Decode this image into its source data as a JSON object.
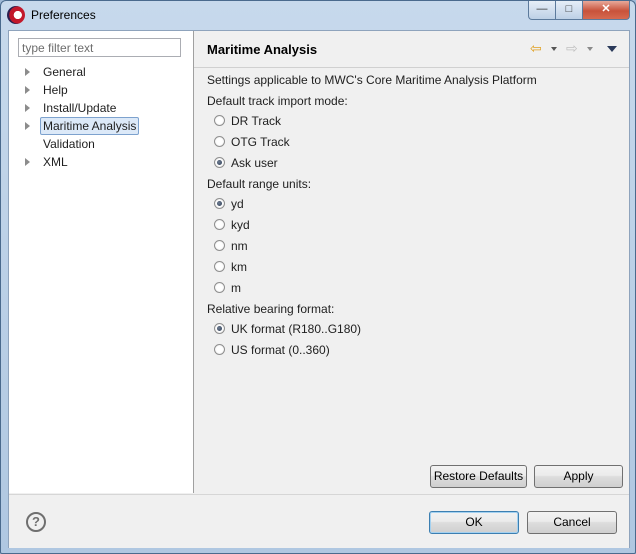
{
  "window": {
    "title": "Preferences"
  },
  "titlebar_controls": {
    "minimize": "—",
    "maximize": "□",
    "close": "✕"
  },
  "filter": {
    "placeholder": "type filter text"
  },
  "tree": {
    "items": [
      {
        "label": "General",
        "expandable": true,
        "selected": false
      },
      {
        "label": "Help",
        "expandable": true,
        "selected": false
      },
      {
        "label": "Install/Update",
        "expandable": true,
        "selected": false
      },
      {
        "label": "Maritime Analysis",
        "expandable": true,
        "selected": true
      },
      {
        "label": "Validation",
        "expandable": false,
        "selected": false
      },
      {
        "label": "XML",
        "expandable": true,
        "selected": false
      }
    ]
  },
  "page": {
    "title": "Maritime Analysis",
    "description": "Settings applicable to MWC's Core Maritime Analysis Platform",
    "groups": [
      {
        "label": "Default track import mode:",
        "options": [
          {
            "label": "DR Track",
            "checked": false
          },
          {
            "label": "OTG Track",
            "checked": false
          },
          {
            "label": "Ask user",
            "checked": true
          }
        ]
      },
      {
        "label": "Default range units:",
        "options": [
          {
            "label": "yd",
            "checked": true
          },
          {
            "label": "kyd",
            "checked": false
          },
          {
            "label": "nm",
            "checked": false
          },
          {
            "label": "km",
            "checked": false
          },
          {
            "label": "m",
            "checked": false
          }
        ]
      },
      {
        "label": "Relative bearing format:",
        "options": [
          {
            "label": "UK format (R180..G180)",
            "checked": true
          },
          {
            "label": "US format (0..360)",
            "checked": false
          }
        ]
      }
    ],
    "restore_defaults_label": "Restore Defaults",
    "apply_label": "Apply"
  },
  "dialog": {
    "ok_label": "OK",
    "cancel_label": "Cancel",
    "help_glyph": "?"
  },
  "colors": {
    "accent": "#3c7fb1",
    "selection_bg": "#dce9f8",
    "close_button": "#c8523b"
  }
}
